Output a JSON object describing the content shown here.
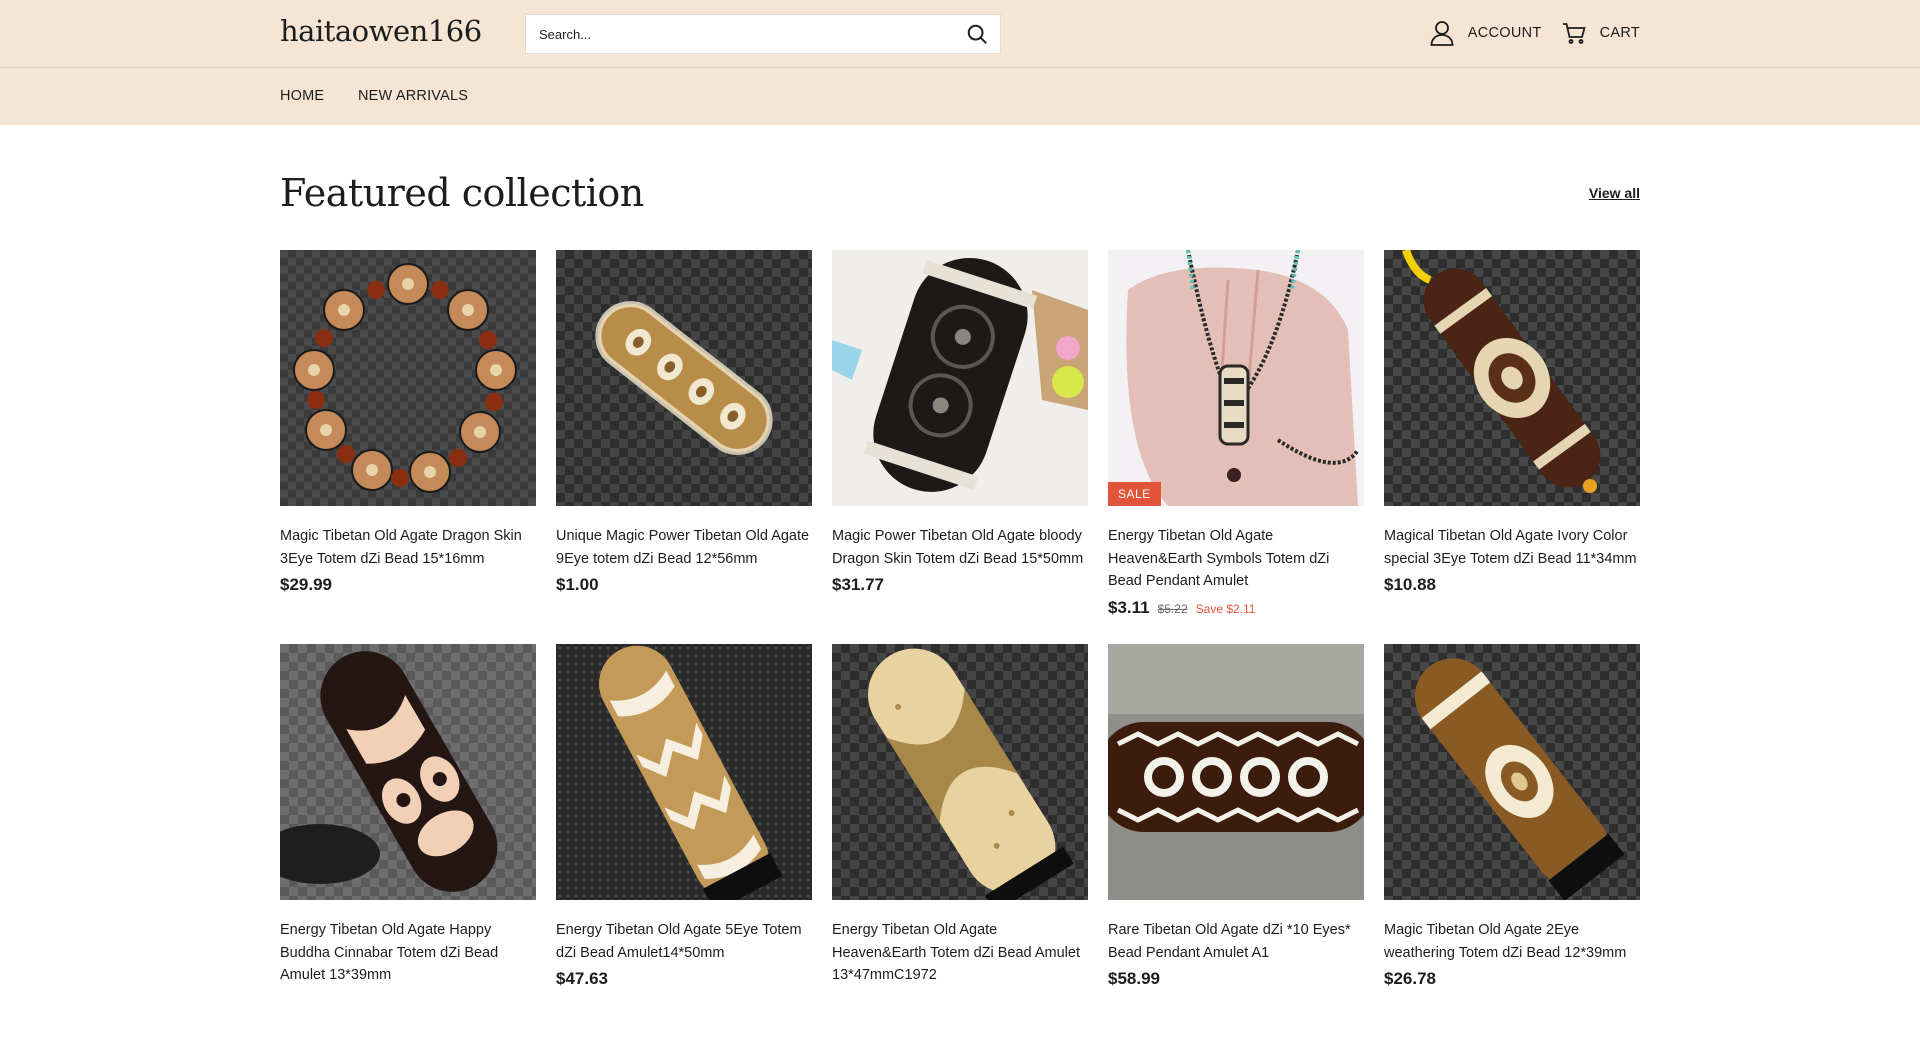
{
  "header": {
    "logo": "haitaowen166",
    "search_placeholder": "Search...",
    "account_label": "ACCOUNT",
    "cart_label": "CART"
  },
  "nav": {
    "items": [
      "HOME",
      "NEW ARRIVALS"
    ]
  },
  "section": {
    "title": "Featured collection",
    "view_all": "View all"
  },
  "products": [
    {
      "title": "Magic Tibetan Old Agate Dragon Skin 3Eye Totem dZi Bead 15*16mm",
      "price": "$29.99",
      "image_icon": "bead-bracelet-image"
    },
    {
      "title": "Unique Magic Power Tibetan Old Agate 9Eye totem dZi Bead 12*56mm",
      "price": "$1.00",
      "image_icon": "dzi-bead-image"
    },
    {
      "title": "Magic Power Tibetan Old Agate bloody Dragon Skin Totem dZi Bead 15*50mm",
      "price": "$31.77",
      "image_icon": "dzi-bead-image"
    },
    {
      "title": "Energy Tibetan Old Agate Heaven&Earth Symbols Totem dZi Bead Pendant Amulet",
      "price": "$3.11",
      "old_price": "$5.22",
      "save": "Save $2.11",
      "badge": "SALE",
      "image_icon": "pendant-in-hand-image"
    },
    {
      "title": "Magical Tibetan Old Agate Ivory Color special 3Eye Totem dZi Bead 11*34mm",
      "price": "$10.88",
      "image_icon": "dzi-bead-image"
    },
    {
      "title": "Energy Tibetan Old Agate Happy Buddha Cinnabar Totem dZi Bead Amulet 13*39mm",
      "price": "",
      "image_icon": "dzi-bead-image"
    },
    {
      "title": "Energy Tibetan Old Agate 5Eye Totem dZi Bead Amulet14*50mm",
      "price": "$47.63",
      "image_icon": "dzi-bead-image"
    },
    {
      "title": "Energy Tibetan Old Agate Heaven&Earth Totem dZi Bead Amulet 13*47mmC1972",
      "price": "",
      "image_icon": "dzi-bead-image"
    },
    {
      "title": "Rare Tibetan Old Agate dZi *10 Eyes* Bead Pendant Amulet A1",
      "price": "$58.99",
      "image_icon": "dzi-bead-image"
    },
    {
      "title": "Magic Tibetan Old Agate 2Eye weathering Totem dZi Bead 12*39mm",
      "price": "$26.78",
      "image_icon": "dzi-bead-image"
    }
  ],
  "colors": {
    "header_bg": "#f6e5d5",
    "sale_accent": "#e2543a",
    "text": "#1c1d1d"
  }
}
